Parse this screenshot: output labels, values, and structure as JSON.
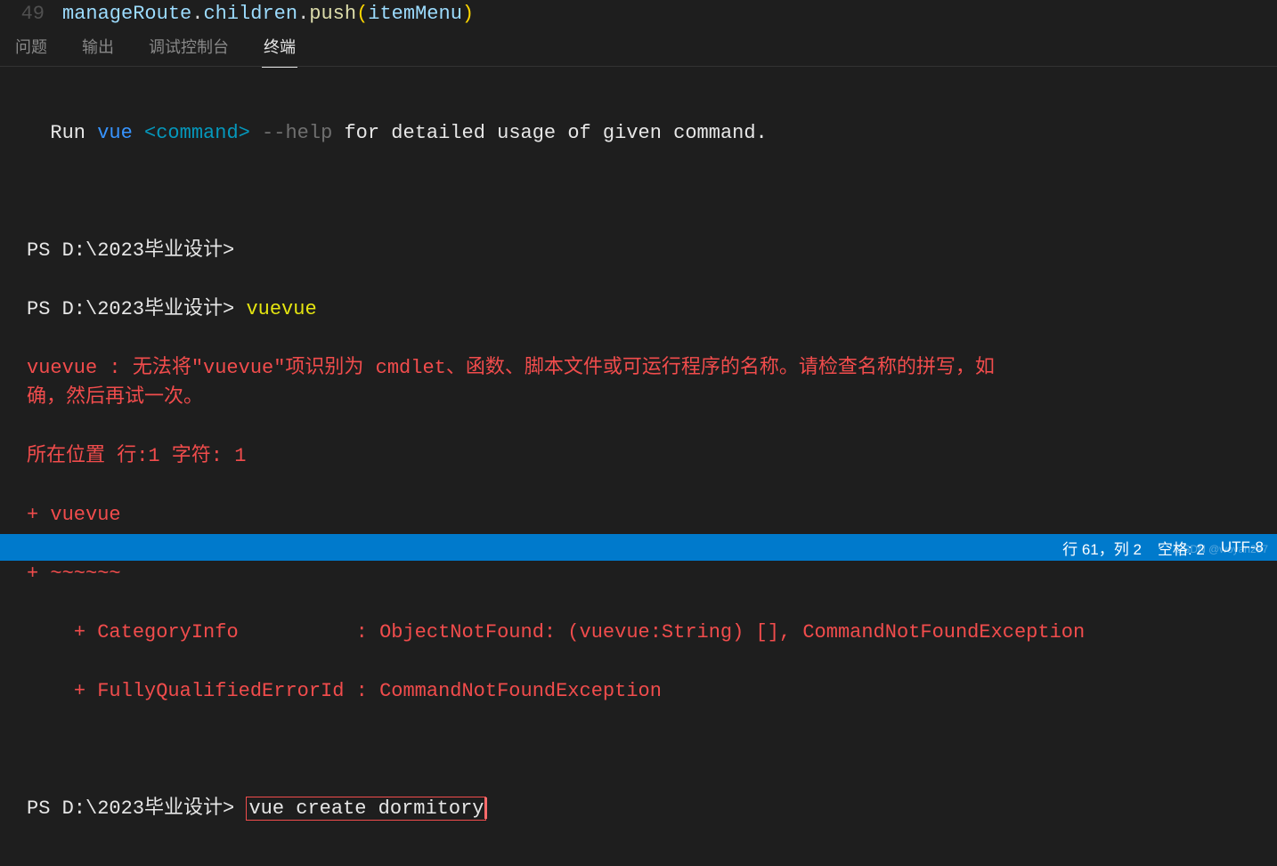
{
  "editor": {
    "line_number": "49",
    "code_var1": "manageRoute",
    "code_dot1": ".",
    "code_prop1": "children",
    "code_dot2": ".",
    "code_method": "push",
    "code_paren_open": "(",
    "code_arg": "itemMenu",
    "code_paren_close": ")"
  },
  "tabs": {
    "problems": "问题",
    "output": "输出",
    "debug": "调试控制台",
    "terminal": "终端"
  },
  "terminal": {
    "hint1": "  Run ",
    "hint_cmd": "vue ",
    "hint_arg": "<command>",
    "hint_flag": " --help",
    "hint2": " for detailed usage of given command.",
    "ps1": "PS D:\\2023毕业设计>",
    "ps2": "PS D:\\2023毕业设计> ",
    "cmd1": "vuevue",
    "err1": "vuevue : 无法将\"vuevue\"项识别为 cmdlet、函数、脚本文件或可运行程序的名称。请检查名称的拼写，如\n确，然后再试一次。",
    "err2": "所在位置 行:1 字符: 1",
    "err3": "+ vuevue",
    "err4": "+ ~~~~~~",
    "err5": "    + CategoryInfo          : ObjectNotFound: (vuevue:String) [], CommandNotFoundException",
    "err6": "    + FullyQualifiedErrorId : CommandNotFoundException",
    "ps3": "PS D:\\2023毕业设计> ",
    "cmd2": "vue create dormitory"
  },
  "status": {
    "pos": "行 61，列 2",
    "spaces": "空格: 2",
    "encoding": "UTF-8"
  },
  "watermark": "CSDN @woyan297"
}
